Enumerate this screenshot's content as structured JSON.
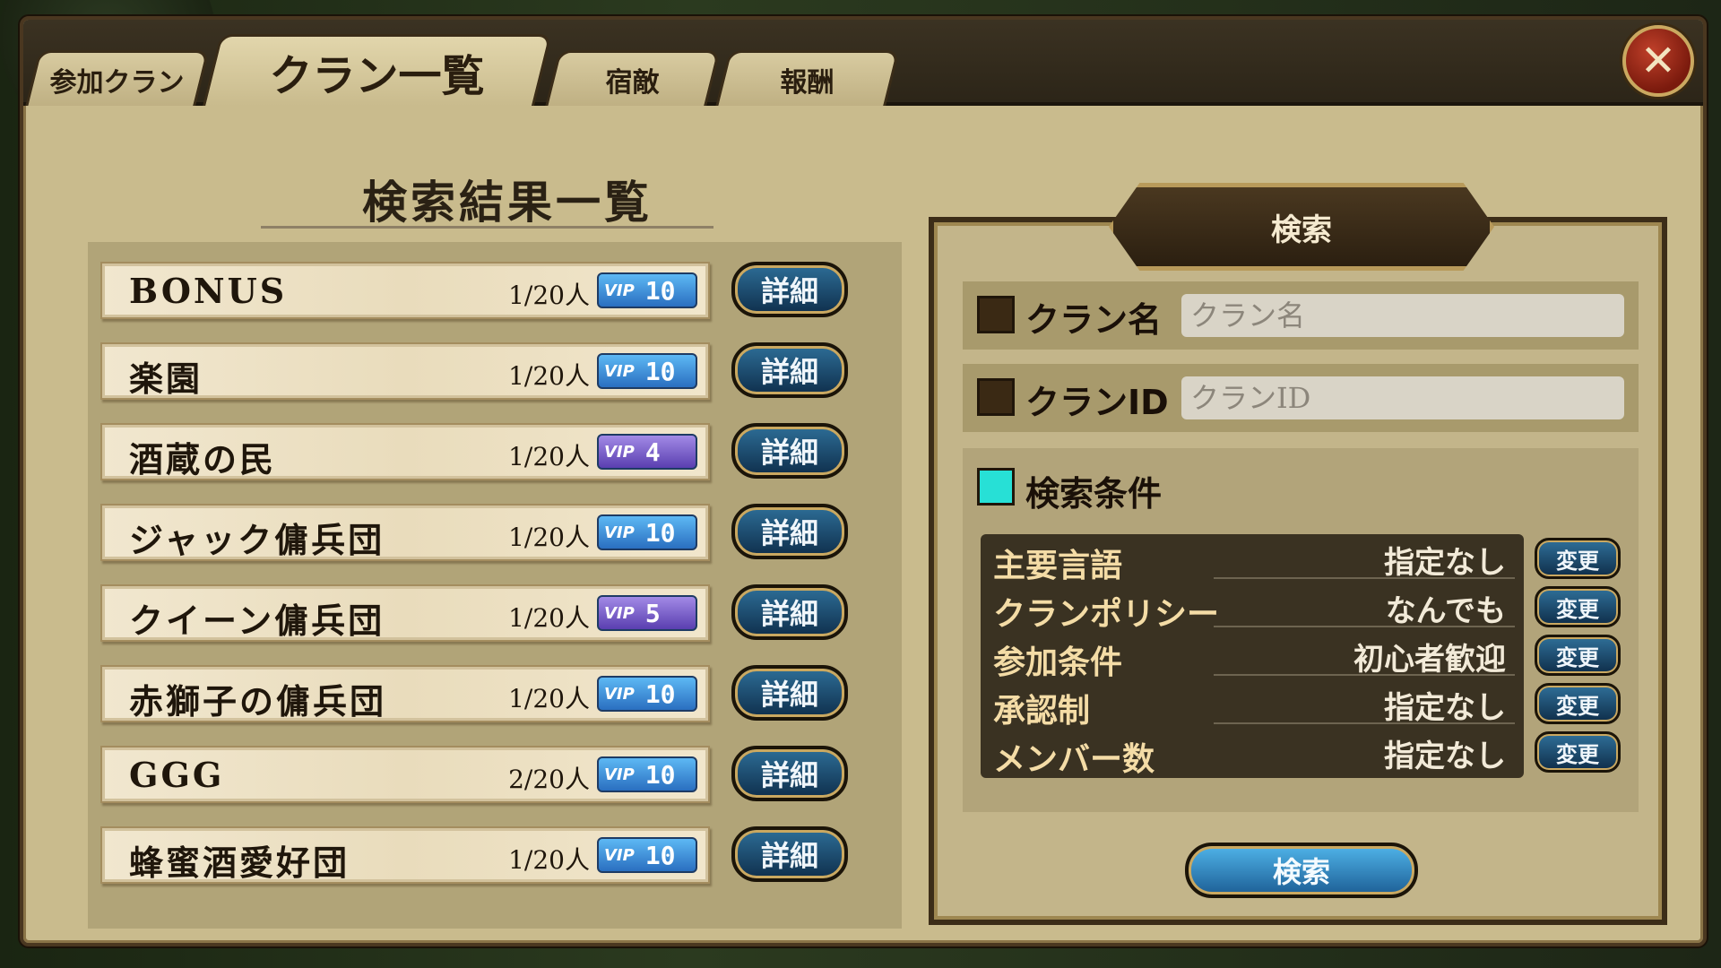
{
  "tabs": {
    "joined": "参加クラン",
    "list": "クラン一覧",
    "rival": "宿敵",
    "reward": "報酬"
  },
  "list": {
    "heading": "検索結果一覧",
    "detail_label": "詳細",
    "vip_label": "VIP",
    "rows": [
      {
        "name": "BONUS",
        "members": "1/20人",
        "vip": "10",
        "vip_color": "#3a8fdc"
      },
      {
        "name": "楽園",
        "members": "1/20人",
        "vip": "10",
        "vip_color": "#3a8fdc"
      },
      {
        "name": "酒蔵の民",
        "members": "1/20人",
        "vip": "4",
        "vip_color": "#7a5fd0"
      },
      {
        "name": "ジャック傭兵団",
        "members": "1/20人",
        "vip": "10",
        "vip_color": "#3a8fdc"
      },
      {
        "name": "クイーン傭兵団",
        "members": "1/20人",
        "vip": "5",
        "vip_color": "#7a5fd0"
      },
      {
        "name": "赤獅子の傭兵団",
        "members": "1/20人",
        "vip": "10",
        "vip_color": "#3a8fdc"
      },
      {
        "name": "GGG",
        "members": "2/20人",
        "vip": "10",
        "vip_color": "#3a8fdc"
      },
      {
        "name": "蜂蜜酒愛好団",
        "members": "1/20人",
        "vip": "10",
        "vip_color": "#3a8fdc"
      }
    ]
  },
  "search": {
    "header": "検索",
    "clan_name_label": "クラン名",
    "clan_name_placeholder": "クラン名",
    "clan_id_label": "クランID",
    "clan_id_placeholder": "クランID",
    "conditions_label": "検索条件",
    "change_label": "変更",
    "conditions": [
      {
        "key": "主要言語",
        "value": "指定なし"
      },
      {
        "key": "クランポリシー",
        "value": "なんでも"
      },
      {
        "key": "参加条件",
        "value": "初心者歓迎"
      },
      {
        "key": "承認制",
        "value": "指定なし"
      },
      {
        "key": "メンバー数",
        "value": "指定なし"
      }
    ],
    "submit_label": "検索"
  },
  "close_icon": "close-icon"
}
